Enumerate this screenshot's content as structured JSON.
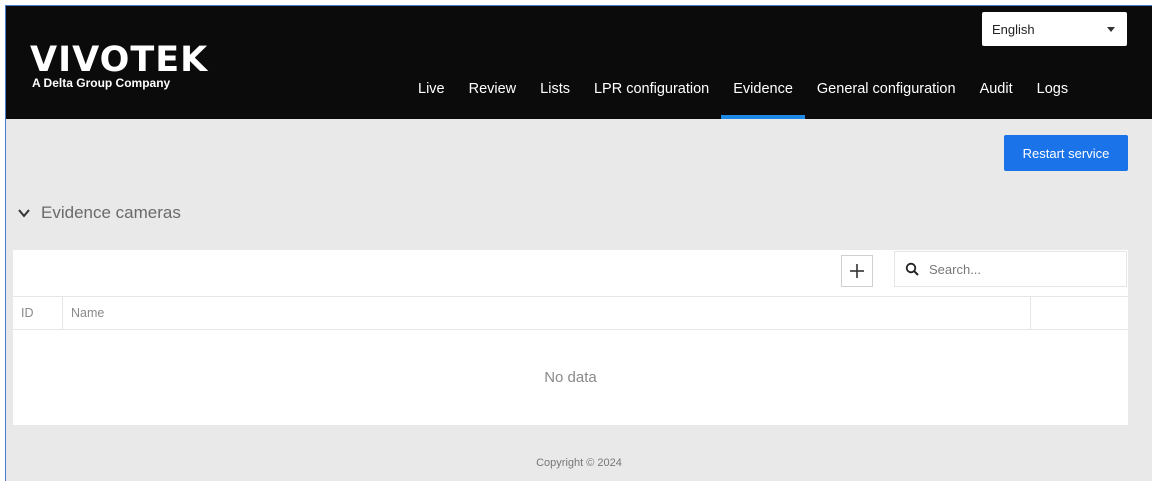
{
  "brand": {
    "name": "VIVOTEK",
    "tagline": "A Delta Group Company"
  },
  "language": {
    "selected": "English"
  },
  "nav": {
    "items": [
      {
        "label": "Live"
      },
      {
        "label": "Review"
      },
      {
        "label": "Lists"
      },
      {
        "label": "LPR configuration"
      },
      {
        "label": "Evidence",
        "active": true
      },
      {
        "label": "General configuration"
      },
      {
        "label": "Audit"
      },
      {
        "label": "Logs"
      }
    ]
  },
  "actions": {
    "restart_label": "Restart service"
  },
  "section": {
    "title": "Evidence cameras",
    "icon": "chevron-down-icon"
  },
  "toolbar": {
    "add_icon": "plus-icon",
    "search_icon": "search-icon",
    "search_placeholder": "Search..."
  },
  "table": {
    "columns": [
      "ID",
      "Name",
      ""
    ],
    "rows": [],
    "empty_text": "No data"
  },
  "footer": {
    "copyright": "Copyright © 2024"
  },
  "colors": {
    "header_bg": "#0b0b0b",
    "accent": "#1a73e8",
    "page_bg": "#e9e9e9"
  }
}
